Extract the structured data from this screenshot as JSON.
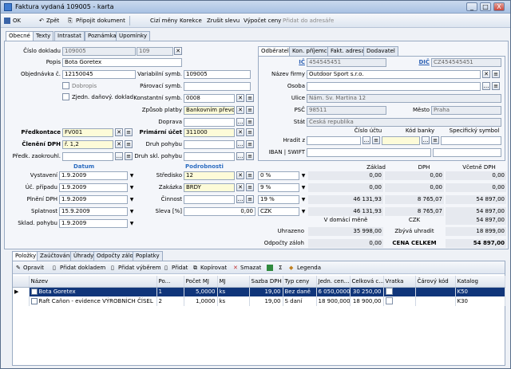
{
  "window": {
    "title": "Faktura vydaná 109005 - karta",
    "min": "_",
    "max": "□",
    "close": "X"
  },
  "toolbar": {
    "ok": "OK",
    "back": "Zpět",
    "attach": "Připojit dokument",
    "foreign": "Cizí měny",
    "correction": "Korekce",
    "cancel_discount": "Zrušit slevu",
    "calc_prices": "Výpočet ceny",
    "add_address": "Přidat do adresáře"
  },
  "tabs": [
    "Obecné",
    "Texty",
    "Intrastat",
    "Poznámka",
    "Upomínky"
  ],
  "form": {
    "cislo_dokladu": {
      "label": "Číslo dokladu",
      "value": "109005",
      "aux": "109"
    },
    "popis": {
      "label": "Popis",
      "value": "Bota Goretex"
    },
    "objednavka": {
      "label": "Objednávka č.",
      "value": "12150045"
    },
    "dobropis": {
      "label": "Dobropis"
    },
    "zjedn": {
      "label": "Zjedn. daňový. doklad"
    },
    "var_symb": {
      "label": "Variabilní symb.",
      "value": "109005"
    },
    "parovaci": {
      "label": "Párovací symb.",
      "value": ""
    },
    "konst": {
      "label": "Konstantní symb.",
      "value": "0008"
    },
    "zpusob": {
      "label": "Způsob platby",
      "value": "Bankovním převodem"
    },
    "doprava": {
      "label": "Doprava",
      "value": ""
    },
    "predkontace": {
      "label": "Předkontace",
      "value": "FV001"
    },
    "cleneni": {
      "label": "Členění DPH",
      "value": "ř. 1,2"
    },
    "predk_zaokr": {
      "label": "Předk. zaokrouhl.",
      "value": ""
    },
    "primarni": {
      "label": "Primární účet",
      "value": "311000"
    },
    "druh_pohybu": {
      "label": "Druh pohybu",
      "value": ""
    },
    "druh_skl": {
      "label": "Druh skl. pohybu",
      "value": ""
    }
  },
  "dates": {
    "title": "Datum",
    "rows": [
      {
        "label": "Vystavení",
        "value": "1.9.2009"
      },
      {
        "label": "Úč. případu",
        "value": "1.9.2009"
      },
      {
        "label": "Plnění DPH",
        "value": "1.9.2009"
      },
      {
        "label": "Splatnost",
        "value": "15.9.2009"
      },
      {
        "label": "Sklad. pohybu",
        "value": "1.9.2009"
      }
    ]
  },
  "details": {
    "title": "Podrobnosti",
    "rows": [
      {
        "label": "Středisko",
        "value": "12"
      },
      {
        "label": "Zakázka",
        "value": "BRDY"
      },
      {
        "label": "Činnost",
        "value": ""
      },
      {
        "label": "Sleva [%]",
        "value": "0,00"
      }
    ]
  },
  "partner_tabs": [
    "Odběratel",
    "Kon. příjemce",
    "Fakt. adresa",
    "Dodavatel"
  ],
  "partner": {
    "ic_label": "IČ",
    "ic": "454545451",
    "dic_label": "DIČ",
    "dic": "CZ454545451",
    "firma_label": "Název firmy",
    "firma": "Outdoor Sport s.r.o.",
    "osoba_label": "Osoba",
    "osoba": "",
    "ulice_label": "Ulice",
    "ulice": "Nám. Sv. Martina 12",
    "psc_label": "PSČ",
    "psc": "98511",
    "mesto_label": "Město",
    "mesto": "Praha",
    "stat_label": "Stát",
    "stat": "Česká republika"
  },
  "bank": {
    "col_ucet": "Číslo účtu",
    "col_kod": "Kód banky",
    "col_spec": "Specifický symbol",
    "hradit_label": "Hradit z",
    "iban_label": "IBAN | SWIFT"
  },
  "vat": {
    "col_zaklad": "Základ",
    "col_dph": "DPH",
    "col_vcetne": "Včetně DPH",
    "rows": [
      {
        "rate": "0 %",
        "zaklad": "0,00",
        "dph": "0,00",
        "vcetne": "0,00"
      },
      {
        "rate": "9 %",
        "zaklad": "0,00",
        "dph": "0,00",
        "vcetne": "0,00"
      },
      {
        "rate": "19 %",
        "zaklad": "46 131,93",
        "dph": "8 765,07",
        "vcetne": "54 897,00"
      }
    ],
    "currency": "CZK",
    "cur_zaklad": "46 131,93",
    "cur_dph": "8 765,07",
    "cur_vcetne": "54 897,00",
    "home_label": "V domácí měně",
    "home_cur": "CZK",
    "home_total": "54 897,00",
    "uhrazeno_label": "Uhrazeno",
    "uhrazeno": "35 998,00",
    "zbyva_label": "Zbývá uhradit",
    "zbyva": "18 899,00",
    "odpocty_label": "Odpočty záloh",
    "odpocty": "0,00",
    "celkem_label": "CENA CELKEM",
    "celkem": "54 897,00"
  },
  "bottom_tabs": [
    "Položky",
    "Zaúčtování",
    "Úhrady",
    "Odpočty záloh",
    "Poplatky"
  ],
  "items_toolbar": {
    "edit": "Opravit",
    "add_doc": "Přidat dokladem",
    "add_select": "Přidat výběrem",
    "add": "Přidat",
    "copy": "Kopírovat",
    "delete": "Smazat",
    "sigma": "Σ",
    "legend": "Legenda"
  },
  "items": {
    "columns": [
      "Název",
      "Po...",
      "Počet MJ",
      "MJ",
      "Sazba DPH",
      "Typ ceny",
      "Jedn. cen...",
      "Celková c...",
      "Vratka",
      "Čárový kód",
      "Katalog"
    ],
    "rows": [
      {
        "name": "Bota Goretex",
        "po": "1",
        "pocet": "5,0000",
        "mj": "ks",
        "sazba": "19,00",
        "typ": "Bez daně",
        "jedn": "6 050,0000",
        "celk": "30 250,00",
        "vratka": "",
        "kod": "",
        "katalog": "K50"
      },
      {
        "name": "Raft Caňon - evidence VÝROBNÍCH ČÍSEL",
        "po": "2",
        "pocet": "1,0000",
        "mj": "ks",
        "sazba": "19,00",
        "typ": "S daní",
        "jedn": "18 900,0000",
        "celk": "18 900,00",
        "vratka": "",
        "kod": "",
        "katalog": "K30"
      }
    ]
  }
}
